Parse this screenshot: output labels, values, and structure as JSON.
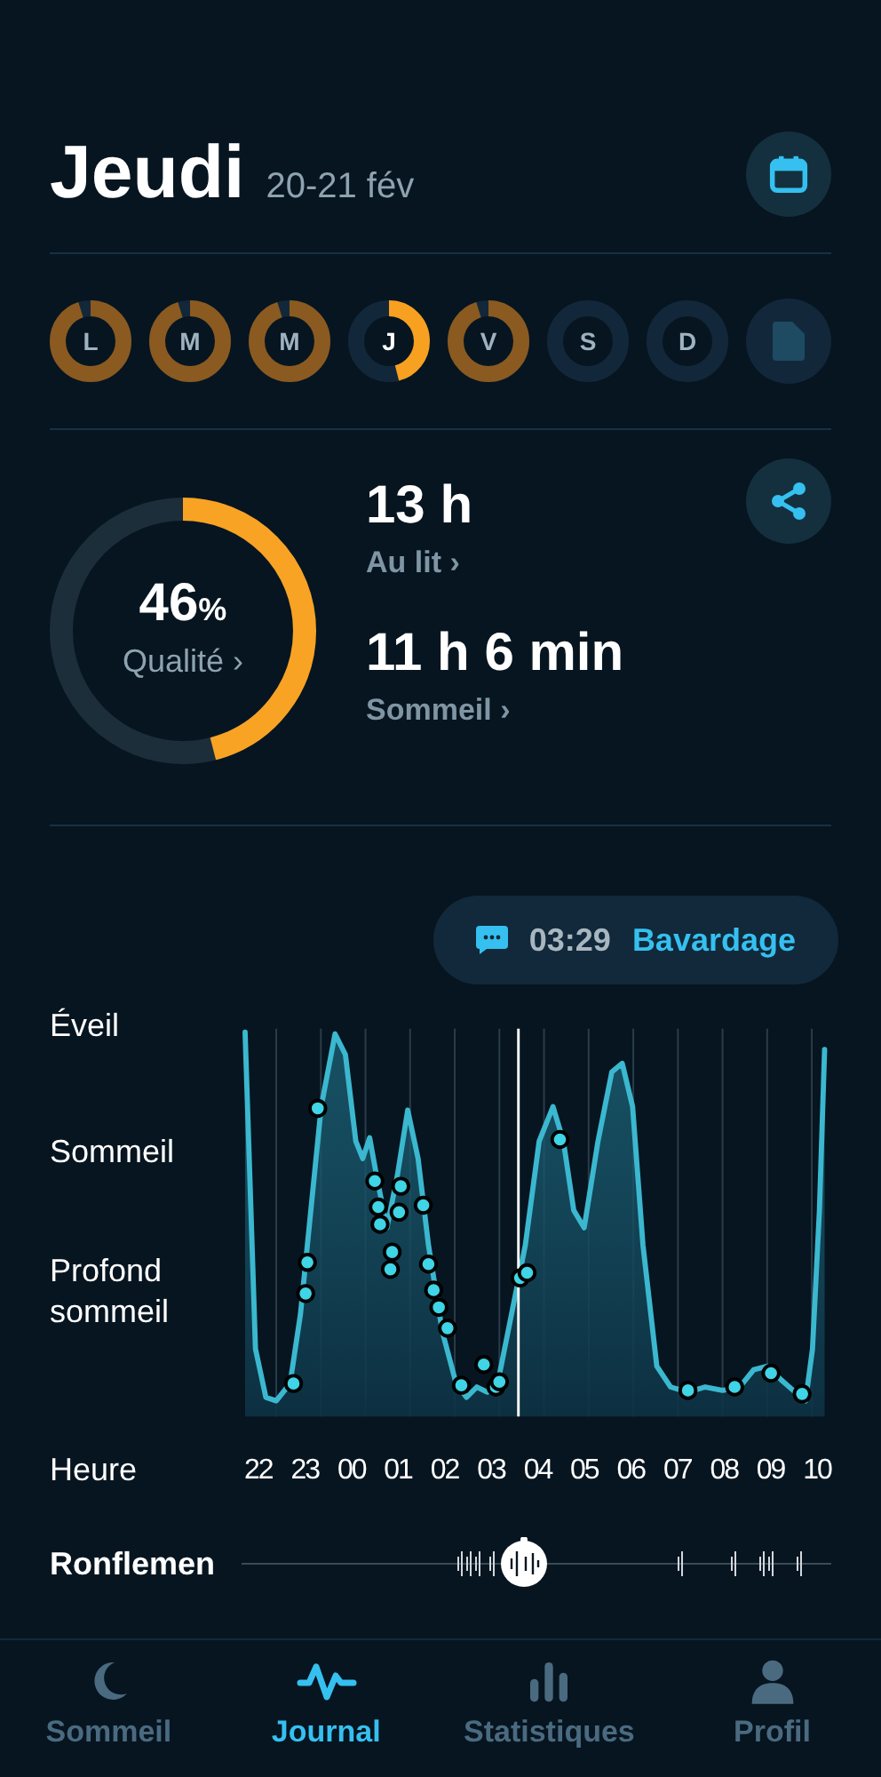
{
  "header": {
    "title": "Jeudi",
    "date": "20-21 fév"
  },
  "days": [
    {
      "label": "L",
      "level": 0.95,
      "selected": false
    },
    {
      "label": "M",
      "level": 0.95,
      "selected": false
    },
    {
      "label": "M",
      "level": 0.95,
      "selected": false
    },
    {
      "label": "J",
      "level": 0.46,
      "selected": true
    },
    {
      "label": "V",
      "level": 0.95,
      "selected": false
    },
    {
      "label": "S",
      "selected": false
    },
    {
      "label": "D",
      "selected": false
    }
  ],
  "quality": {
    "value": "46",
    "unit": "%",
    "label": "Qualité ›",
    "level": 0.46
  },
  "stats": [
    {
      "value": "13 h",
      "label": "Au lit ›"
    },
    {
      "value": "11 h 6 min",
      "label": "Sommeil ›"
    }
  ],
  "event": {
    "time": "03:29",
    "label": "Bavardage"
  },
  "chart": {
    "y_labels": [
      "Éveil",
      "Sommeil",
      "Profond sommeil"
    ],
    "x_title": "Heure",
    "x_labels": [
      "22",
      "23",
      "00",
      "01",
      "02",
      "03",
      "04",
      "05",
      "06",
      "07",
      "08",
      "09",
      "10"
    ]
  },
  "snoring": {
    "label": "Ronflemen"
  },
  "nav": [
    {
      "label": "Sommeil",
      "kind": "moon",
      "selected": false
    },
    {
      "label": "Journal",
      "kind": "wave",
      "selected": true
    },
    {
      "label": "Statistiques",
      "kind": "bars",
      "selected": false
    },
    {
      "label": "Profil",
      "kind": "person",
      "selected": false
    }
  ]
}
